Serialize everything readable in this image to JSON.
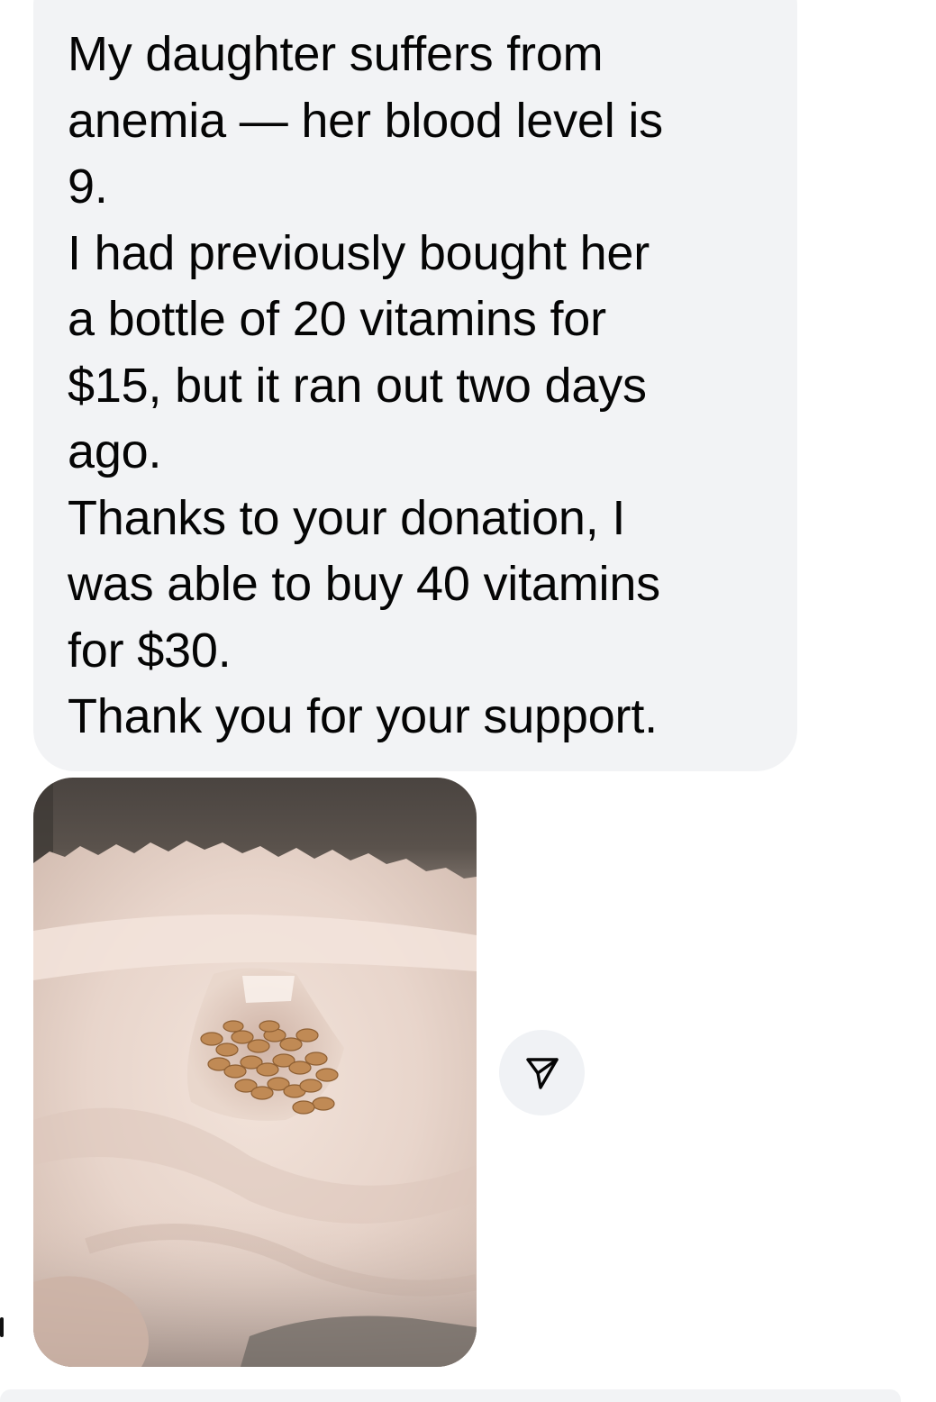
{
  "message": {
    "lines": [
      "My daughter suffers from",
      "anemia — her blood level is",
      "9.",
      "I had previously bought her",
      "a bottle of 20 vitamins for",
      "$15, but it ran out two days",
      "ago.",
      "Thanks to your donation, I",
      "was able to buy 40 vitamins",
      "for $30.",
      "Thank you for your support."
    ]
  },
  "attachment": {
    "kind": "photo",
    "subject": "pills-in-paper-bag-photo"
  },
  "actions": {
    "share_icon": "send-paper-plane-icon"
  },
  "colors": {
    "bubble_background": "#f2f3f5",
    "text": "#050505",
    "share_button_background": "#f0f2f5",
    "icon": "#050505"
  }
}
